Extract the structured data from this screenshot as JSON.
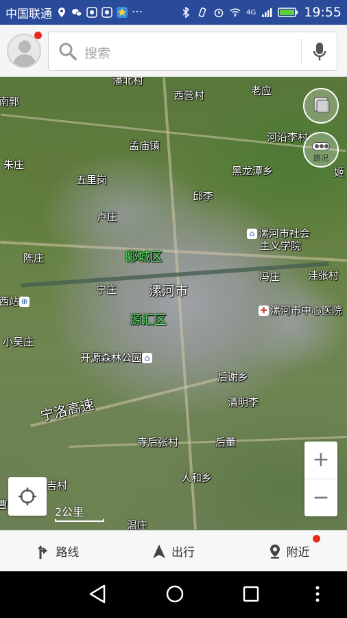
{
  "status_bar": {
    "carrier": "中国联通",
    "network_label": "4G",
    "time": "19:55",
    "icons": [
      "location-icon",
      "wechat-icon",
      "app-icon",
      "app-icon",
      "star-app-icon",
      "more-icon",
      "bluetooth-icon",
      "vibrate-icon",
      "alarm-icon",
      "wifi-icon",
      "signal-icon",
      "battery-icon"
    ]
  },
  "search": {
    "placeholder": "搜索",
    "has_notification": true
  },
  "map": {
    "type": "satellite",
    "labels": [
      {
        "text": "潘北村"
      },
      {
        "text": "西营村"
      },
      {
        "text": "老应"
      },
      {
        "text": "南郭"
      },
      {
        "text": "孟庙镇"
      },
      {
        "text": "河沿李村"
      },
      {
        "text": "朱庄"
      },
      {
        "text": "黑龙潭乡"
      },
      {
        "text": "姬"
      },
      {
        "text": "五里岗"
      },
      {
        "text": "邱李"
      },
      {
        "text": "卢庄"
      },
      {
        "text": "漯河市社会"
      },
      {
        "text": "主义学院"
      },
      {
        "text": "陈庄"
      },
      {
        "text": "冯庄"
      },
      {
        "text": "洼张村"
      },
      {
        "text": "宁庄"
      },
      {
        "text": "漯河市"
      },
      {
        "text": "西站"
      },
      {
        "text": "漯河市中心医院"
      },
      {
        "text": "小吴庄"
      },
      {
        "text": "开源森林公园"
      },
      {
        "text": "后谢乡"
      },
      {
        "text": "清明李"
      },
      {
        "text": "寺后张村"
      },
      {
        "text": "后董"
      },
      {
        "text": "人和乡"
      },
      {
        "text": "吉村"
      },
      {
        "text": "温庄"
      },
      {
        "text": "曹"
      }
    ],
    "districts": [
      "郾城区",
      "源汇区"
    ],
    "highway": "宁洛高速",
    "traffic_label": "路况",
    "scale_label": "2公里",
    "zoom_in": "+",
    "zoom_out": "−"
  },
  "tabs": [
    {
      "label": "路线",
      "icon": "route-icon"
    },
    {
      "label": "出行",
      "icon": "navigation-arrow-icon"
    },
    {
      "label": "附近",
      "icon": "location-pin-icon"
    }
  ]
}
